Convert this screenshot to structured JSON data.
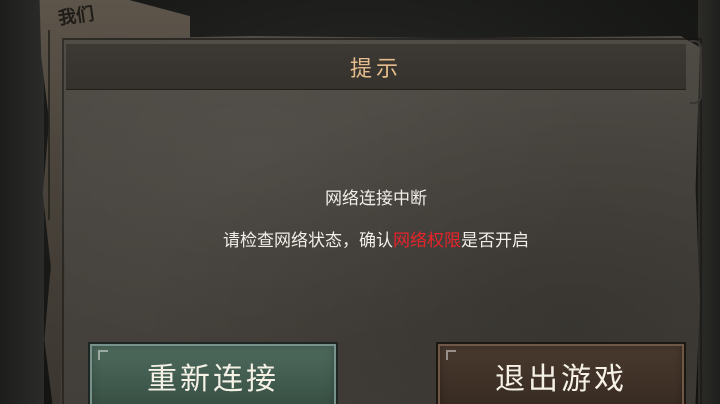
{
  "dialog": {
    "title": "提示",
    "message_line1": "网络连接中断",
    "message_line2_prefix": "请检查网络状态，确认",
    "message_line2_highlight": "网络权限",
    "message_line2_suffix": "是否开启",
    "highlight_color": "#e8232a",
    "title_color": "#e5bd8c"
  },
  "buttons": {
    "reconnect_label": "重新连接",
    "exit_label": "退出游戏"
  },
  "background": {
    "scrap_mark": "我们"
  },
  "colors": {
    "reconnect_button": "#4f6b5e",
    "exit_button": "#4a3a2e",
    "paper": "#4a4641"
  }
}
